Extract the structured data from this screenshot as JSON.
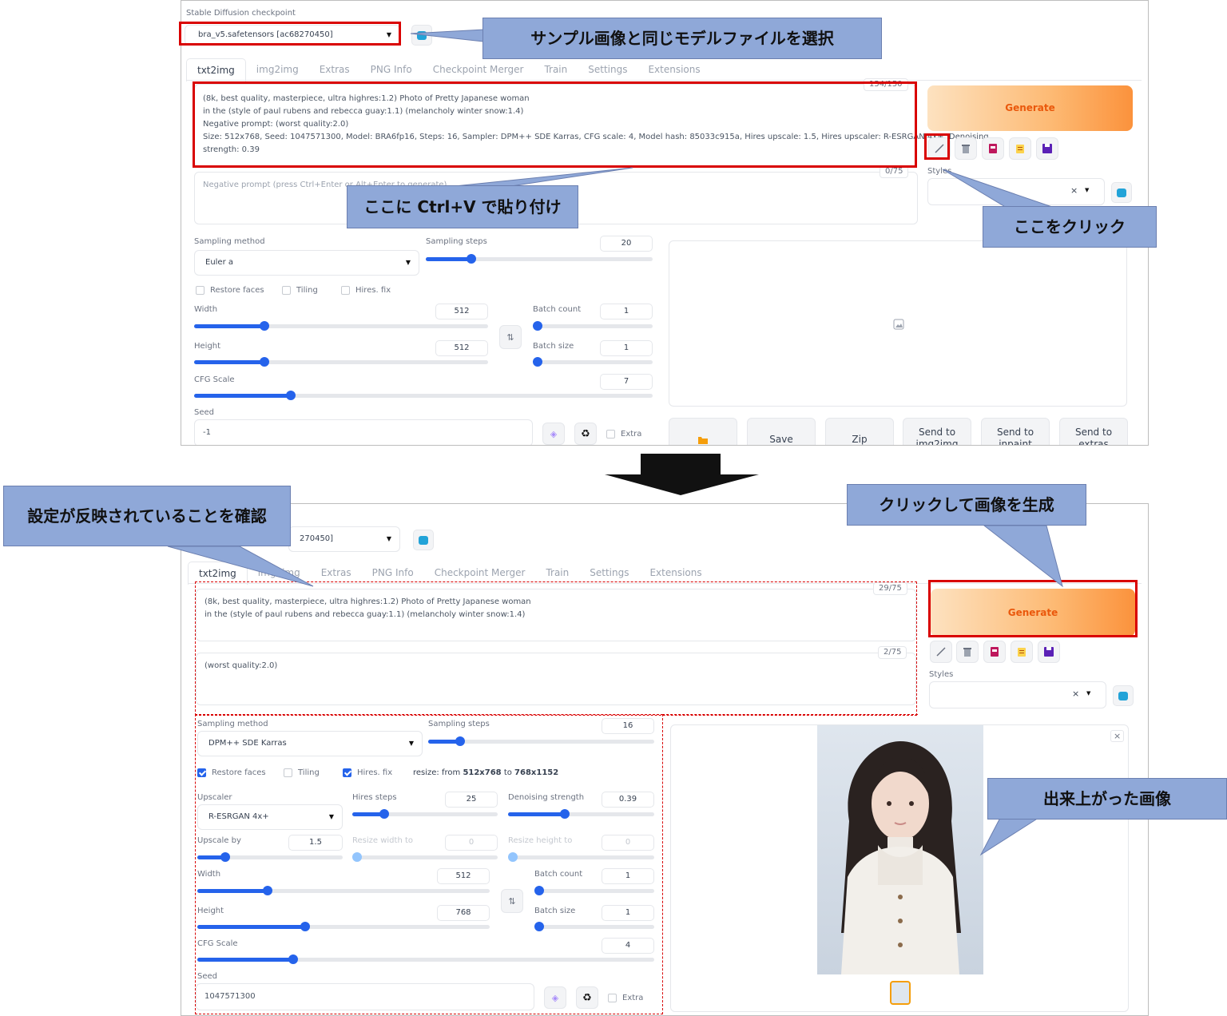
{
  "top_screen": {
    "checkpoint_label": "Stable Diffusion checkpoint",
    "checkpoint_value": "bra_v5.safetensors [ac68270450]",
    "tabs": [
      "txt2img",
      "img2img",
      "Extras",
      "PNG Info",
      "Checkpoint Merger",
      "Train",
      "Settings",
      "Extensions"
    ],
    "prompt_lines": [
      "(8k, best quality, masterpiece, ultra highres:1.2) Photo of Pretty Japanese woman",
      " in the (style of paul rubens and rebecca guay:1.1) (melancholy winter snow:1.4)",
      "Negative prompt: (worst quality:2.0)",
      "Size: 512x768, Seed: 1047571300, Model: BRA6fp16, Steps: 16, Sampler: DPM++ SDE Karras, CFG scale: 4, Model hash: 85033c915a, Hires upscale: 1.5, Hires upscaler: R-ESRGAN 4x+, Denoising",
      "strength: 0.39"
    ],
    "prompt_counter": "154/150",
    "negative_placeholder": "Negative prompt (press Ctrl+Enter or Alt+Enter to generate)",
    "negative_counter": "0/75",
    "generate_label": "Generate",
    "styles_label": "Styles",
    "styles_clear": "×",
    "sampling_method_label": "Sampling method",
    "sampling_method_value": "Euler a",
    "sampling_steps_label": "Sampling steps",
    "sampling_steps_value": "20",
    "restore_faces": "Restore faces",
    "tiling": "Tiling",
    "hires_fix": "Hires. fix",
    "width_label": "Width",
    "width_value": "512",
    "height_label": "Height",
    "height_value": "512",
    "batch_count_label": "Batch count",
    "batch_count_value": "1",
    "batch_size_label": "Batch size",
    "batch_size_value": "1",
    "cfg_label": "CFG Scale",
    "cfg_value": "7",
    "seed_label": "Seed",
    "seed_value": "-1",
    "extra_label": "Extra",
    "output_buttons": [
      "Save",
      "Zip",
      "Send to img2img",
      "Send to inpaint",
      "Send to extras"
    ],
    "sliders": {
      "steps": 0.2,
      "width": 0.24,
      "height": 0.24,
      "batch_count": 0,
      "batch_size": 0,
      "cfg": 0.21
    }
  },
  "bottom_screen": {
    "checkpoint_value_partial": "270450]",
    "tabs": [
      "txt2img",
      "img2img",
      "Extras",
      "PNG Info",
      "Checkpoint Merger",
      "Train",
      "Settings",
      "Extensions"
    ],
    "prompt_lines": [
      "(8k, best quality, masterpiece, ultra highres:1.2) Photo of Pretty Japanese woman",
      " in the (style of paul rubens and rebecca guay:1.1) (melancholy winter snow:1.4)"
    ],
    "prompt_counter": "29/75",
    "negative_value": "(worst quality:2.0)",
    "negative_counter": "2/75",
    "generate_label": "Generate",
    "styles_label": "Styles",
    "styles_clear": "×",
    "sampling_method_label": "Sampling method",
    "sampling_method_value": "DPM++ SDE Karras",
    "sampling_steps_label": "Sampling steps",
    "sampling_steps_value": "16",
    "restore_faces": "Restore faces",
    "tiling": "Tiling",
    "hires_fix": "Hires. fix",
    "resize_prefix": "resize: from ",
    "resize_from": "512x768",
    "resize_to_word": " to ",
    "resize_to": "768x1152",
    "upscaler_label": "Upscaler",
    "upscaler_value": "R-ESRGAN 4x+",
    "hires_steps_label": "Hires steps",
    "hires_steps_value": "25",
    "denoising_label": "Denoising strength",
    "denoising_value": "0.39",
    "upscale_by_label": "Upscale by",
    "upscale_by_value": "1.5",
    "resize_width_label": "Resize width to",
    "resize_width_value": "0",
    "resize_height_label": "Resize height to",
    "resize_height_value": "0",
    "width_label": "Width",
    "width_value": "512",
    "height_label": "Height",
    "height_value": "768",
    "batch_count_label": "Batch count",
    "batch_count_value": "1",
    "batch_size_label": "Batch size",
    "batch_size_value": "1",
    "cfg_label": "CFG Scale",
    "cfg_value": "4",
    "seed_label": "Seed",
    "seed_value": "1047571300",
    "extra_label": "Extra",
    "close_label": "×",
    "sliders": {
      "steps": 0.14,
      "hires_steps": 0.22,
      "denoising": 0.39,
      "upscale_by": 0.19,
      "resize_width": 0,
      "resize_height": 0,
      "width": 0.24,
      "height": 0.37,
      "batch_count": 0,
      "batch_size": 0,
      "cfg": 0.21
    }
  },
  "annotations": {
    "select_model": "サンプル画像と同じモデルファイルを選択",
    "paste_here": "ここに Ctrl+V で貼り付け",
    "click_here": "ここをクリック",
    "confirm_settings": "設定が反映されていることを確認",
    "click_generate": "クリックして画像を生成",
    "result_image": "出来上がった画像"
  },
  "colors": {
    "accent": "#2563eb",
    "generate_start": "#fde2c0",
    "generate_end": "#fb923c",
    "callout": "#8fa8d8",
    "highlight": "#d90000"
  },
  "icons": [
    "refresh-icon",
    "pencil-icon",
    "trash-icon",
    "style-book-icon",
    "clipboard-icon",
    "save-disk-icon",
    "dice-icon",
    "recycle-icon",
    "swap-icon",
    "folder-icon",
    "image-placeholder-icon",
    "arrow-down-icon"
  ]
}
